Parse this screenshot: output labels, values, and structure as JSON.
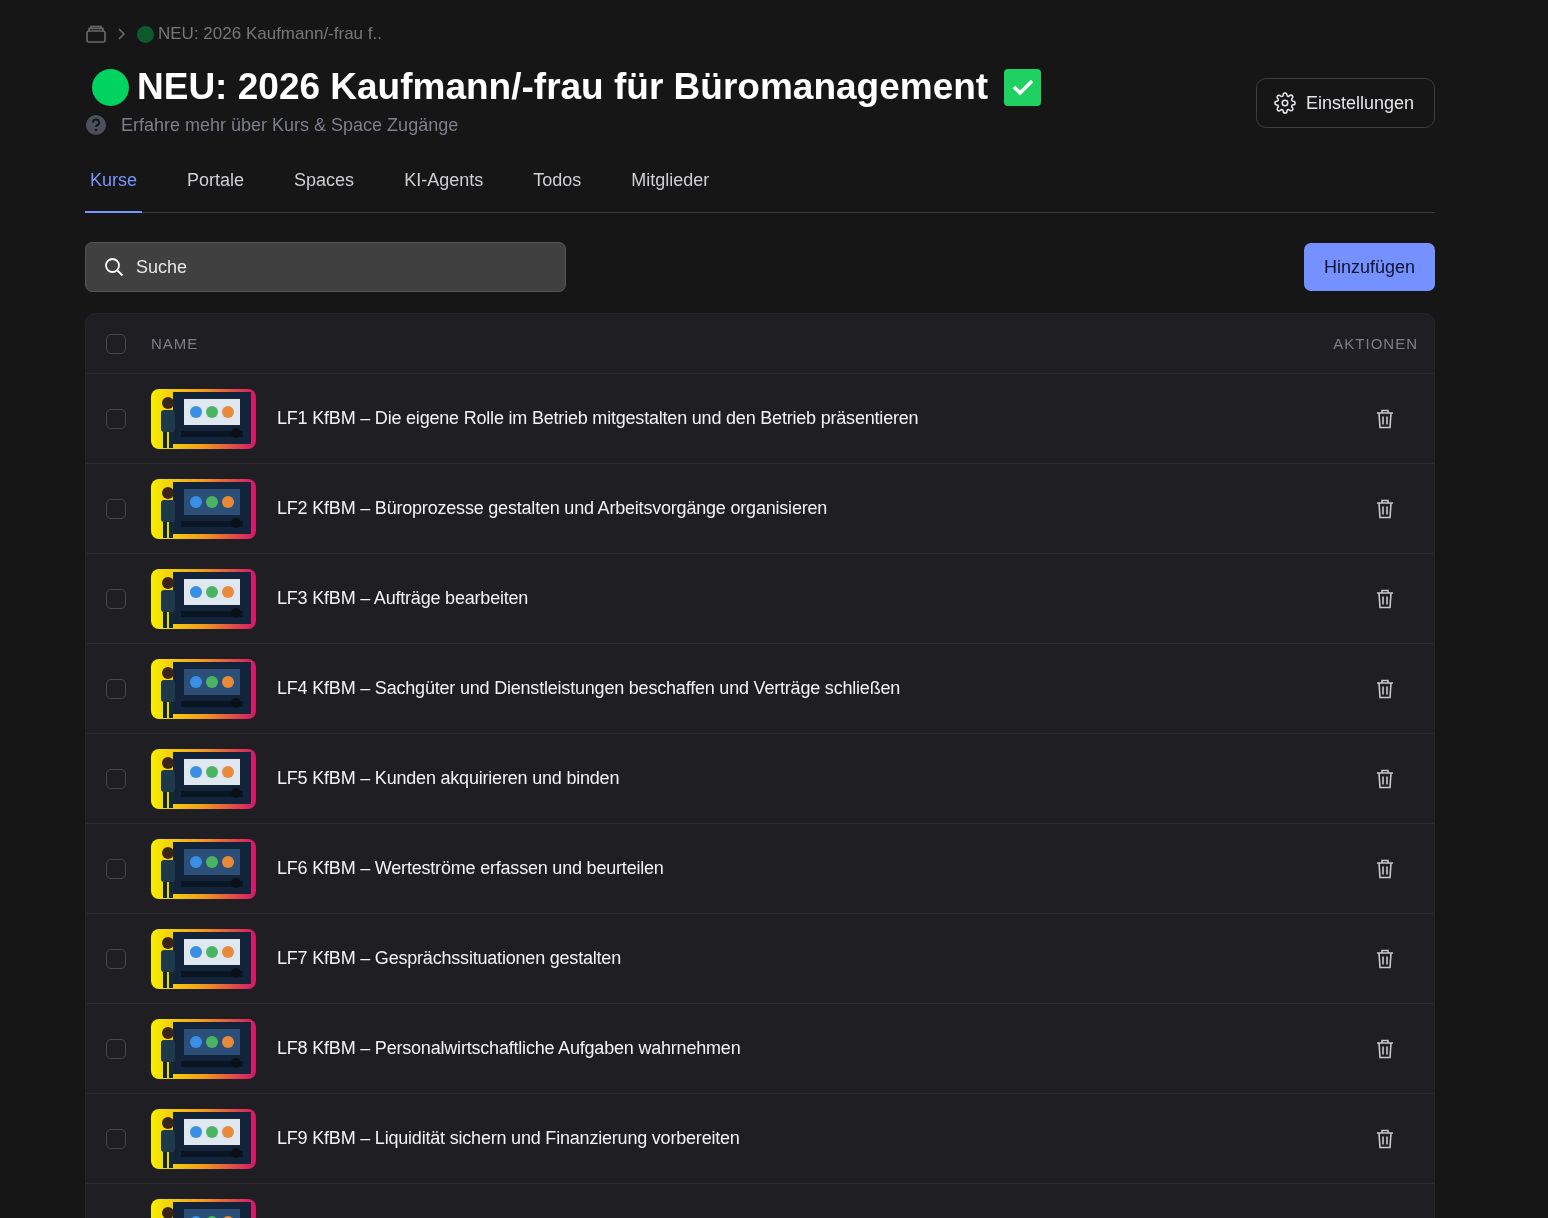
{
  "breadcrumb": {
    "current": {
      "label": "NEU: 2026 Kaufmann/-frau f..",
      "color": "#0e5a2e"
    }
  },
  "header": {
    "title": "NEU: 2026 Kaufmann/-frau für Büromanagement",
    "status": {
      "color": "#00d35f"
    },
    "verified": true,
    "help_link": "Erfahre mehr über Kurs & Space Zugänge",
    "settings_button": "Einstellungen"
  },
  "tabs": [
    {
      "label": "Kurse",
      "selected": true
    },
    {
      "label": "Portale",
      "selected": false
    },
    {
      "label": "Spaces",
      "selected": false
    },
    {
      "label": "KI-Agents",
      "selected": false
    },
    {
      "label": "Todos",
      "selected": false
    },
    {
      "label": "Mitglieder",
      "selected": false
    }
  ],
  "search": {
    "placeholder": "Suche"
  },
  "add_button": "Hinzufügen",
  "table": {
    "select_all": false,
    "columns": [
      "NAME",
      "AKTIONEN"
    ],
    "rows": [
      {
        "title": "LF1 KfBM – Die eigene Rolle im Betrieb mitgestalten und den Betrieb präsentieren",
        "checked": false,
        "thumbnail": {
          "kind": "picture"
        }
      },
      {
        "title": "LF2 KfBM – Büroprozesse gestalten und Arbeitsvorgänge organisieren",
        "checked": false,
        "thumbnail": {
          "kind": "picture"
        }
      },
      {
        "title": "LF3 KfBM – Aufträge bearbeiten",
        "checked": false,
        "thumbnail": {
          "kind": "picture"
        }
      },
      {
        "title": "LF4 KfBM – Sachgüter und Dienstleistungen beschaffen und Verträge schließen",
        "checked": false,
        "thumbnail": {
          "kind": "picture"
        }
      },
      {
        "title": "LF5 KfBM – Kunden akquirieren und binden",
        "checked": false,
        "thumbnail": {
          "kind": "picture"
        }
      },
      {
        "title": "LF6 KfBM – Werteströme erfassen und beurteilen",
        "checked": false,
        "thumbnail": {
          "kind": "picture"
        }
      },
      {
        "title": "LF7 KfBM – Gesprächssituationen gestalten",
        "checked": false,
        "thumbnail": {
          "kind": "picture"
        }
      },
      {
        "title": "LF8 KfBM – Personalwirtschaftliche Aufgaben wahrnehmen",
        "checked": false,
        "thumbnail": {
          "kind": "picture"
        }
      },
      {
        "title": "LF9 KfBM – Liquidität sichern und Finanzierung vorbereiten",
        "checked": false,
        "thumbnail": {
          "kind": "picture"
        }
      },
      {
        "thumbnail": {
          "kind": "picture"
        }
      }
    ]
  }
}
